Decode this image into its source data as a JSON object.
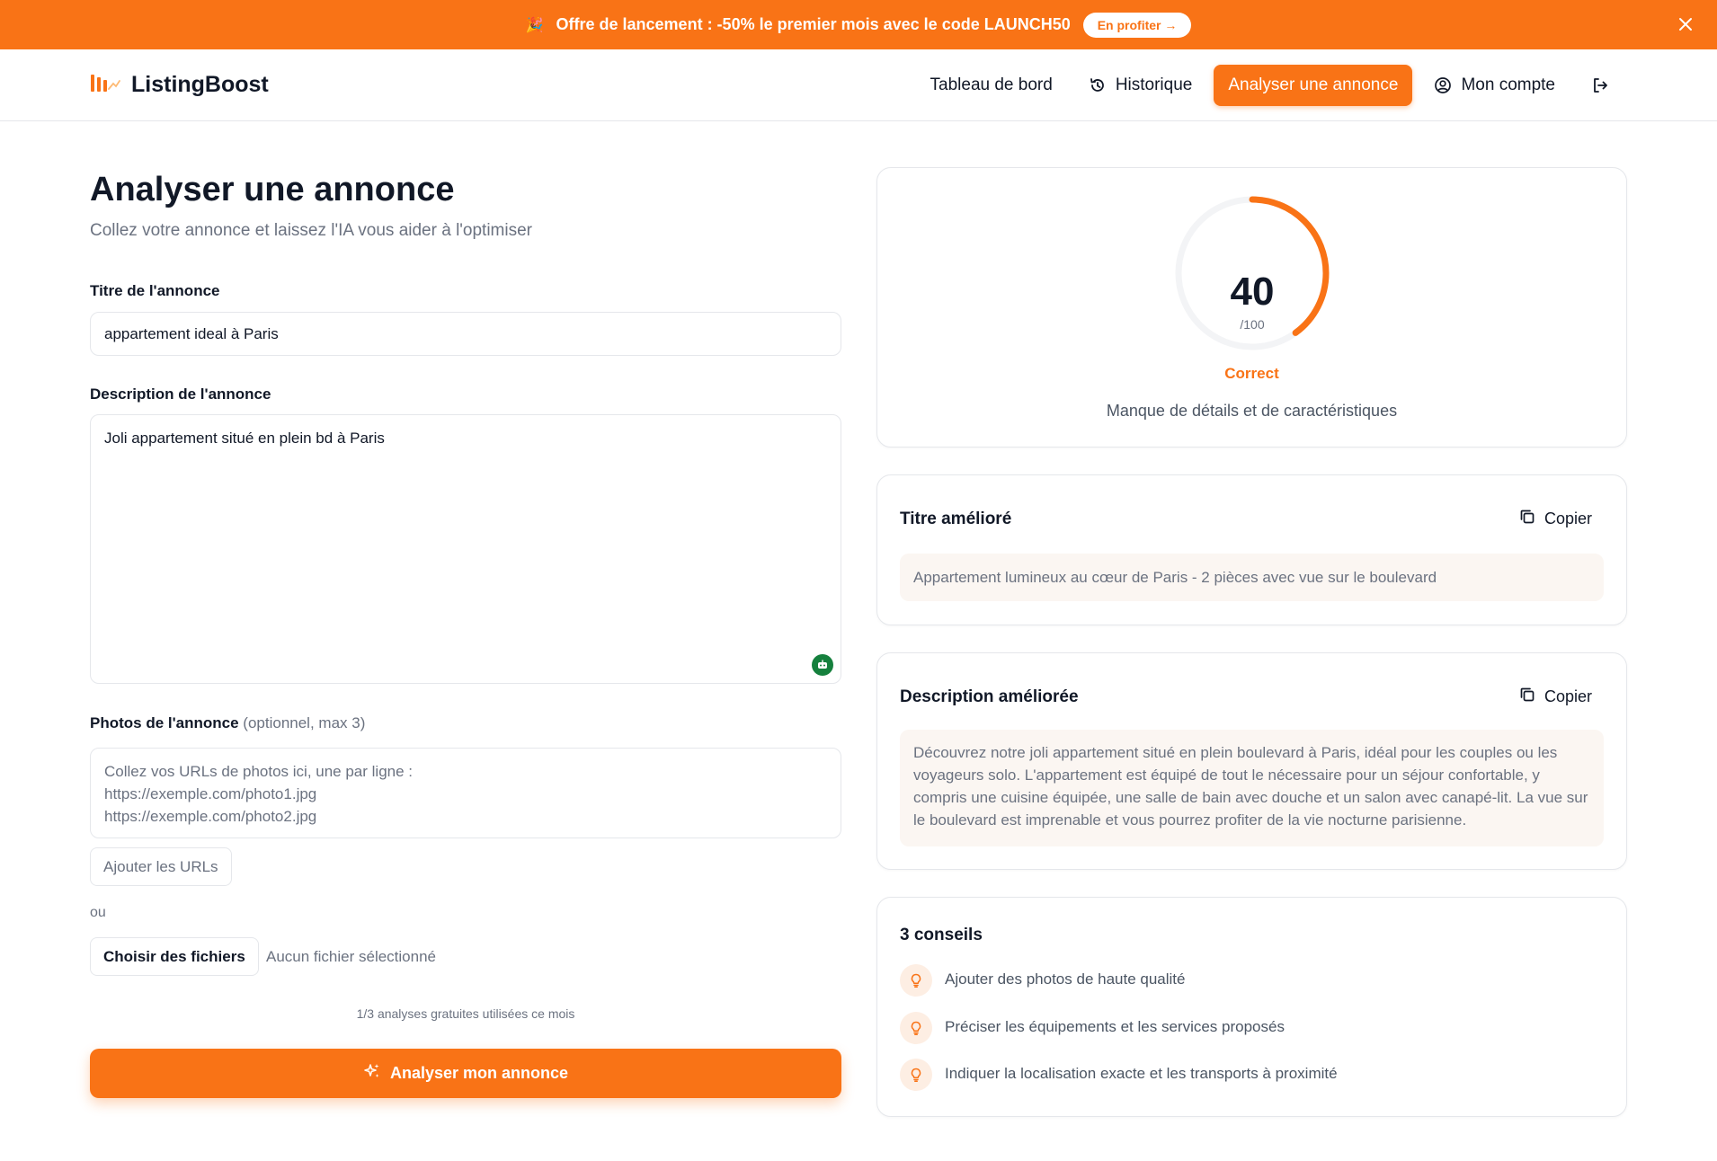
{
  "promo": {
    "emoji": "🎉",
    "text": "Offre de lancement : -50% le premier mois avec le code LAUNCH50",
    "cta": "En profiter →"
  },
  "brand": {
    "name": "ListingBoost"
  },
  "nav": {
    "items": [
      {
        "label": "Tableau de bord"
      },
      {
        "label": "Historique"
      },
      {
        "label": "Analyser une annonce"
      },
      {
        "label": "Mon compte"
      }
    ]
  },
  "page": {
    "title": "Analyser une annonce",
    "subtitle": "Collez votre annonce et laissez l'IA vous aider à l'optimiser"
  },
  "form": {
    "title_label": "Titre de l'annonce",
    "title_value": "appartement ideal à Paris",
    "desc_label": "Description de l'annonce",
    "desc_value": "Joli appartement situé en plein bd à Paris",
    "photos_label": "Photos de l'annonce",
    "photos_optional": "(optionnel, max 3)",
    "photos_placeholder": "Collez vos URLs de photos ici, une par ligne :\nhttps://exemple.com/photo1.jpg\nhttps://exemple.com/photo2.jpg",
    "add_urls": "Ajouter les URLs",
    "or": "ou",
    "choose_files": "Choisir des fichiers",
    "no_file": "Aucun fichier sélectionné",
    "usage": "1/3 analyses gratuites utilisées ce mois",
    "submit": "Analyser mon annonce"
  },
  "score": {
    "value": 40,
    "max_label": "/100",
    "max": 100,
    "rating": "Correct",
    "description": "Manque de détails et de caractéristiques",
    "accent": "#f97316"
  },
  "improved_title": {
    "heading": "Titre amélioré",
    "copy": "Copier",
    "text": "Appartement lumineux au cœur de Paris - 2 pièces avec vue sur le boulevard"
  },
  "improved_desc": {
    "heading": "Description améliorée",
    "copy": "Copier",
    "text": "Découvrez notre joli appartement situé en plein boulevard à Paris, idéal pour les couples ou les voyageurs solo. L'appartement est équipé de tout le nécessaire pour un séjour confortable, y compris une cuisine équipée, une salle de bain avec douche et un salon avec canapé-lit. La vue sur le boulevard est imprenable et vous pourrez profiter de la vie nocturne parisienne."
  },
  "tips": {
    "heading": "3 conseils",
    "items": [
      "Ajouter des photos de haute qualité",
      "Préciser les équipements et les services proposés",
      "Indiquer la localisation exacte et les transports à proximité"
    ]
  },
  "colors": {
    "brand": "#f97316",
    "result_bg": "#fbf6f2"
  }
}
